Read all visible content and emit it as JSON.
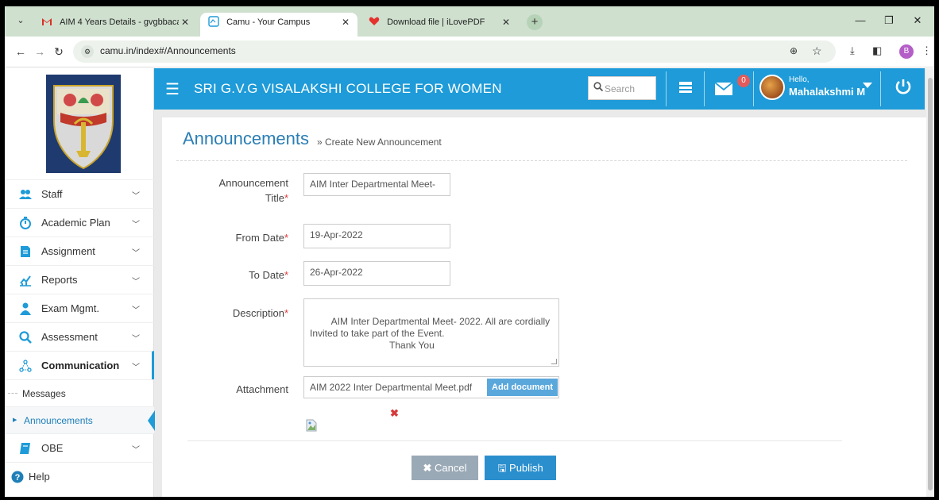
{
  "browser": {
    "tabs": [
      {
        "label": "AIM 4 Years Details - gvgbbaca",
        "close": "✕",
        "icon": "gmail-icon"
      },
      {
        "label": "Camu - Your Campus",
        "close": "✕",
        "icon": "camu-icon"
      },
      {
        "label": "Download file | iLovePDF",
        "close": "✕",
        "icon": "ilovepdf-heart-icon"
      }
    ],
    "new_tab": "+",
    "url": "camu.in/index#/Announcements",
    "profile_initial": "B",
    "window": {
      "minimize": "—",
      "restore": "❐",
      "close": "✕"
    }
  },
  "header": {
    "college": "SRI G.V.G VISALAKSHI COLLEGE FOR WOMEN",
    "search_placeholder": "Search",
    "message_count": "0",
    "hello": "Hello,",
    "user_name": "Mahalakshmi M"
  },
  "sidebar": {
    "items": [
      {
        "label": "Staff",
        "icon": "staff-icon"
      },
      {
        "label": "Academic Plan",
        "icon": "academic-plan-icon"
      },
      {
        "label": "Assignment",
        "icon": "assignment-icon"
      },
      {
        "label": "Reports",
        "icon": "reports-icon"
      },
      {
        "label": "Exam Mgmt.",
        "icon": "exam-mgmt-icon"
      },
      {
        "label": "Assessment",
        "icon": "assessment-icon"
      },
      {
        "label": "Communication",
        "icon": "communication-icon"
      },
      {
        "label": "OBE",
        "icon": "obe-icon"
      },
      {
        "label": "Help",
        "icon": "help-icon"
      }
    ],
    "sub_items": [
      {
        "label": "Messages"
      },
      {
        "label": "Announcements"
      }
    ]
  },
  "page": {
    "title": "Announcements",
    "breadcrumb": "» Create New Announcement"
  },
  "form": {
    "title_label_1": "Announcement",
    "title_label_2": "Title",
    "title_value": "AIM Inter Departmental Meet-",
    "from_label": "From Date",
    "from_value": "19-Apr-2022",
    "to_label": "To Date",
    "to_value": "26-Apr-2022",
    "desc_label": "Description",
    "desc_value": "AIM Inter Departmental Meet- 2022. All are cordially\nInvited to take part of the Event.\n                              Thank You",
    "attach_label": "Attachment",
    "attach_value": "AIM 2022 Inter Departmental Meet.pdf",
    "add_document": "Add document",
    "required_mark": "*"
  },
  "buttons": {
    "cancel": "Cancel",
    "publish": "Publish"
  },
  "colors": {
    "header_blue": "#1e9bd8",
    "title_blue": "#2b7eb4",
    "publish_blue": "#2b8fce",
    "cancel_gray": "#9aa9b6",
    "required_red": "#e23b3b"
  }
}
